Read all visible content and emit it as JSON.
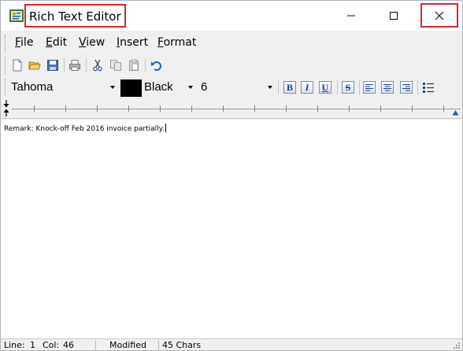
{
  "window": {
    "title": "Rich Text Editor",
    "app_icon": "notepad-app-icon",
    "controls": {
      "minimize": "minimize-icon",
      "maximize": "maximize-icon",
      "close": "close-icon"
    }
  },
  "menu": {
    "items": [
      {
        "label": "File",
        "accel": "F",
        "rest": "ile"
      },
      {
        "label": "Edit",
        "accel": "E",
        "rest": "dit"
      },
      {
        "label": "View",
        "accel": "V",
        "rest": "iew"
      },
      {
        "label": "Insert",
        "accel": "I",
        "rest": "nsert"
      },
      {
        "label": "Format",
        "accel": "F",
        "rest": "ormat"
      }
    ]
  },
  "toolbar": {
    "buttons": [
      "new-document-icon",
      "open-folder-icon",
      "save-disk-icon",
      "print-icon",
      "cut-icon",
      "copy-icon",
      "paste-icon",
      "undo-icon"
    ]
  },
  "format_bar": {
    "font_name": "Tahoma",
    "color_name": "Black",
    "color_value": "#000000",
    "font_size": "6",
    "bold_glyph": "B",
    "italic_glyph": "I",
    "underline_glyph": "U",
    "strike_glyph": "S"
  },
  "editor": {
    "content": "Remark: Knock-off Feb 2016 invoice partially."
  },
  "status": {
    "line_label": "Line:",
    "line_value": "1",
    "col_label": "Col:",
    "col_value": "46",
    "modified": "Modified",
    "chars": "45 Chars"
  },
  "colors": {
    "highlight_border": "#d6262e",
    "chrome_bg": "#f0f0f0"
  }
}
